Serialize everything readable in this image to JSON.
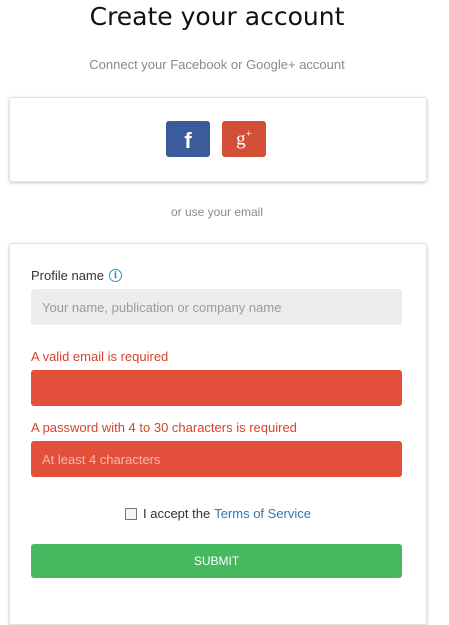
{
  "header": {
    "title": "Create your account",
    "subtitle": "Connect your Facebook or Google+ account"
  },
  "social": {
    "facebook_icon": "f",
    "google_icon": "g",
    "google_icon_sup": "+",
    "facebook_color": "#3b5c9a",
    "google_color": "#d44f38"
  },
  "divider": {
    "text": "or use your email"
  },
  "form": {
    "profile_label": "Profile name",
    "profile_info_icon": "i",
    "profile_placeholder": "Your name, publication or company name",
    "profile_value": "",
    "email_error": "A valid email is required",
    "email_value": "",
    "password_error": "A password with 4 to 30 characters is required",
    "password_placeholder": "At least 4 characters",
    "terms_text": "I accept the",
    "terms_link": "Terms of Service",
    "terms_checked": false,
    "submit_label": "SUBMIT",
    "error_color": "#e24f3b",
    "submit_color": "#46b860"
  }
}
